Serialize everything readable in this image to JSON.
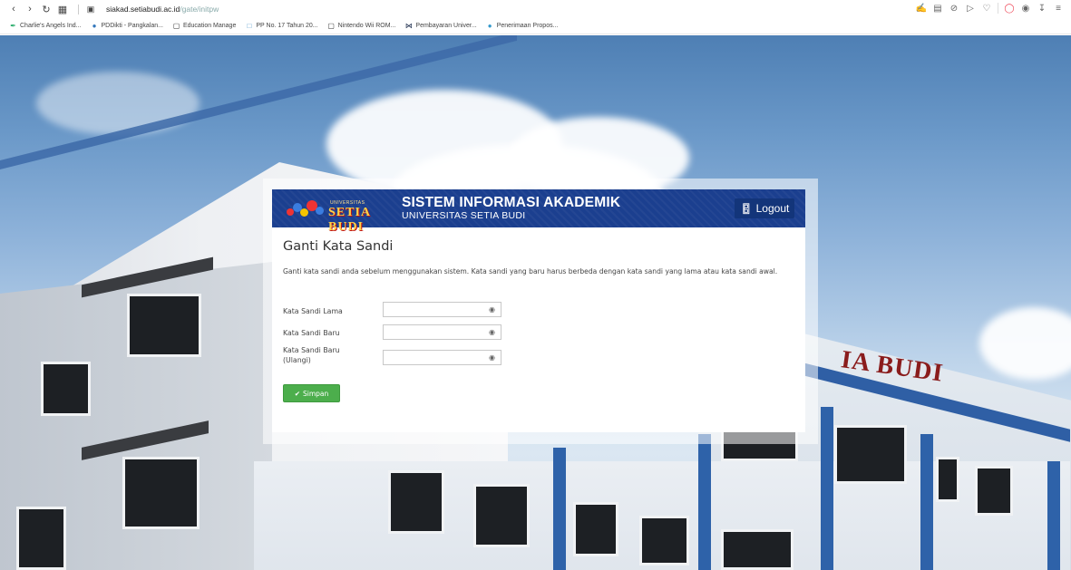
{
  "browser": {
    "url_host": "siakad.setiabudi.ac.id",
    "url_path": "/gate/initpw",
    "bookmarks": [
      {
        "label": "Charlie's Angels Ind...",
        "icon": "pen-icon"
      },
      {
        "label": "PDDikti - Pangkalan...",
        "icon": "globe-icon"
      },
      {
        "label": "Education Manage",
        "icon": "folder-icon"
      },
      {
        "label": "PP No. 17 Tahun 20...",
        "icon": "document-icon"
      },
      {
        "label": "Nintendo Wii ROM...",
        "icon": "folder-icon"
      },
      {
        "label": "Pembayaran Univer...",
        "icon": "link-icon"
      },
      {
        "label": "Penerimaan Propos...",
        "icon": "globe-icon"
      }
    ]
  },
  "header": {
    "logo_tagline": "UNIVERSITAS",
    "logo_name": "SETIA BUDI",
    "title": "SISTEM INFORMASI AKADEMIK",
    "subtitle": "UNIVERSITAS SETIA BUDI",
    "logout_label": "Logout"
  },
  "main": {
    "page_title": "Ganti Kata Sandi",
    "description": "Ganti kata sandi anda sebelum menggunakan sistem. Kata sandi yang baru harus berbeda dengan kata sandi yang lama atau kata sandi awal.",
    "fields": [
      {
        "label": "Kata Sandi Lama",
        "value": ""
      },
      {
        "label": "Kata Sandi Baru",
        "value": ""
      },
      {
        "label": "Kata Sandi Baru (Ulangi)",
        "value": ""
      }
    ],
    "save_label": "Simpan"
  },
  "background": {
    "building_sign": "IA BUDI"
  },
  "colors": {
    "header_bg": "#1b3f8f",
    "save_button": "#4cae4c",
    "logout_button": "#13357a"
  }
}
